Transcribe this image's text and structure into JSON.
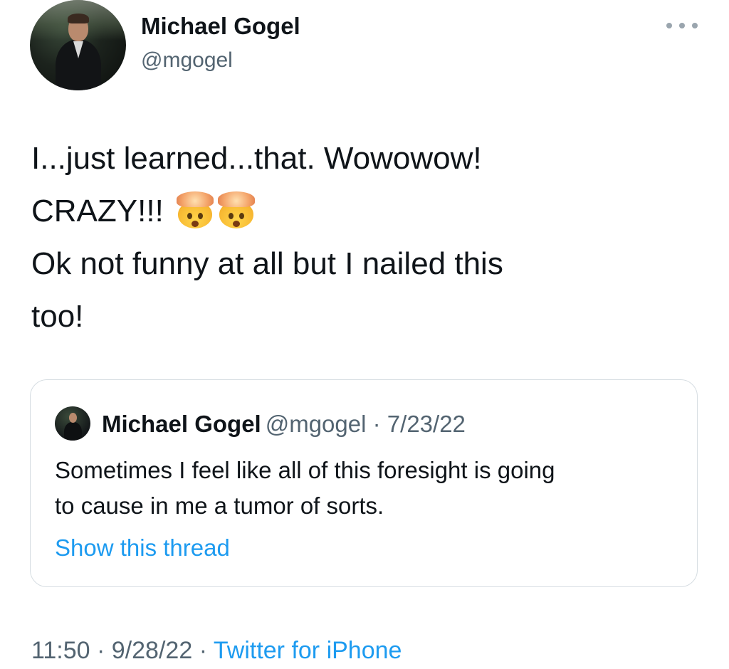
{
  "tweet": {
    "author": {
      "name": "Michael Gogel",
      "handle": "@mgogel"
    },
    "more_icon": "more-horizontal-icon",
    "text_lines": [
      "I...just learned...that. Wowowow!",
      "CRAZY!!!",
      "Ok not funny at all but I nailed this",
      "too!"
    ],
    "emoji": [
      "exploding-head-emoji",
      "exploding-head-emoji"
    ],
    "quoted_tweet": {
      "author_name": "Michael Gogel",
      "author_handle": "@mgogel",
      "separator": "·",
      "date": "7/23/22",
      "text_lines": [
        "Sometimes I feel like all of this foresight is going",
        "to cause in me a tumor of sorts."
      ],
      "show_thread_label": "Show this thread"
    },
    "meta": {
      "time": "11:50",
      "sep1": "·",
      "date": "9/28/22",
      "sep2": "·",
      "source": "Twitter for iPhone"
    }
  },
  "colors": {
    "text": "#0f1419",
    "secondary": "#536471",
    "link": "#1d9bf0",
    "border": "#d6dde2"
  }
}
